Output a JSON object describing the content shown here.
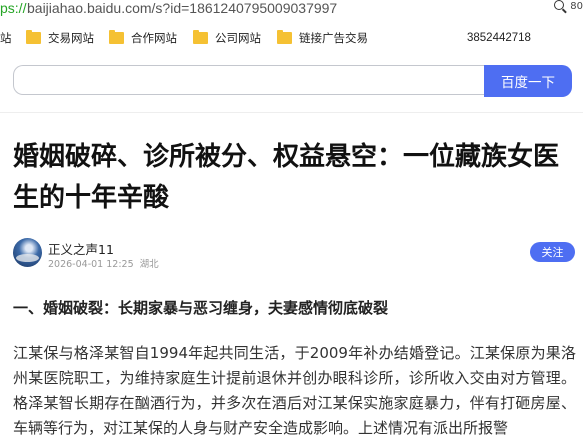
{
  "address_bar": {
    "scheme": "ps://",
    "url": "baijiahao.baidu.com/s?id=1861240795009037997",
    "zoom": "80"
  },
  "bookmarks": {
    "truncated_item": "站",
    "items": [
      "交易网站",
      "合作网站",
      "公司网站",
      "链接广告交易"
    ],
    "phone": "3852442718"
  },
  "search": {
    "value": "",
    "placeholder": "",
    "button_label": "百度一下"
  },
  "article": {
    "title": "婚姻破碎、诊所被分、权益悬空：一位藏族女医生的十年辛酸",
    "author": {
      "name": "正义之声11",
      "date": "2026-04-01 12:25",
      "location": "湖北",
      "follow_label": "关注"
    },
    "section_heading": "一、婚姻破裂：长期家暴与恶习缠身，夫妻感情彻底破裂",
    "paragraph": "江某保与格泽某智自1994年起共同生活，于2009年补办结婚登记。江某保原为果洛州某医院职工，为维持家庭生计提前退休并创办眼科诊所，诊所收入交由对方管理。格泽某智长期存在酗酒行为，并多次在酒后对江某保实施家庭暴力，伴有打砸房屋、车辆等行为，对江某保的人身与财产安全造成影响。上述情况有派出所报警"
  }
}
